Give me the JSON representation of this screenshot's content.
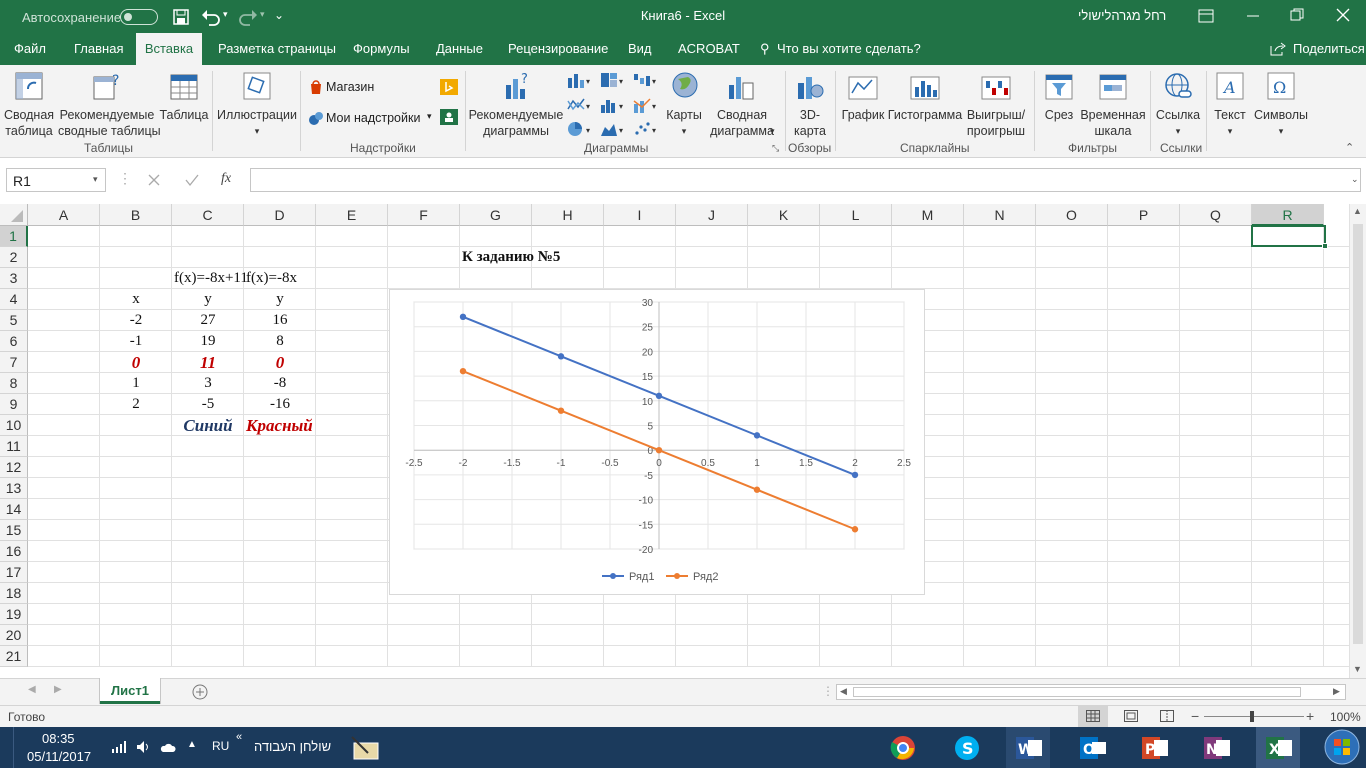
{
  "titlebar": {
    "autosave_label": "Автосохранение",
    "title": "Книга6  -  Excel",
    "user": "רחל מגרהלישולי"
  },
  "tabs": [
    "Файл",
    "Главная",
    "Вставка",
    "Разметка страницы",
    "Формулы",
    "Данные",
    "Рецензирование",
    "Вид",
    "ACROBAT"
  ],
  "active_tab": "Вставка",
  "tell_me": "Что вы хотите сделать?",
  "share": "Поделиться",
  "ribbon": {
    "pivot": [
      "Сводная",
      "таблица"
    ],
    "rec_pivot": [
      "Рекомендуемые",
      "сводные таблицы"
    ],
    "table": "Таблица",
    "illustrations": "Иллюстрации",
    "store": "Магазин",
    "my_addins": "Мои надстройки",
    "rec_charts": [
      "Рекомендуемые",
      "диаграммы"
    ],
    "maps": "Карты",
    "pivot_chart": [
      "Сводная",
      "диаграмма"
    ],
    "map3d": [
      "3D-",
      "карта"
    ],
    "line": "График",
    "hist": "Гистограмма",
    "winloss": [
      "Выигрыш/",
      "проигрыш"
    ],
    "slicer": "Срез",
    "timeline": [
      "Временная",
      "шкала"
    ],
    "link": "Ссылка",
    "text": "Текст",
    "symbols": "Символы",
    "groups": {
      "tables": "Таблицы",
      "addins": "Надстройки",
      "charts": "Диаграммы",
      "tours": "Обзоры",
      "sparklines": "Спарклайны",
      "filters": "Фильтры",
      "links": "Ссылки"
    }
  },
  "formula": {
    "namebox": "R1",
    "fx": "fx",
    "value": ""
  },
  "columns": [
    "A",
    "B",
    "C",
    "D",
    "E",
    "F",
    "G",
    "H",
    "I",
    "J",
    "K",
    "L",
    "M",
    "N",
    "O",
    "P",
    "Q",
    "R"
  ],
  "rows": [
    "1",
    "2",
    "3",
    "4",
    "5",
    "6",
    "7",
    "8",
    "9",
    "10",
    "11",
    "12",
    "13",
    "14",
    "15",
    "16",
    "17",
    "18",
    "19",
    "20",
    "21"
  ],
  "cells": {
    "G2": "К заданию №5",
    "C3": "f(x)=-8x+11",
    "D3": "f(x)=-8x",
    "B4": "x",
    "C4": "y",
    "D4": "y",
    "B5": "-2",
    "C5": "27",
    "D5": "16",
    "B6": "-1",
    "C6": "19",
    "D6": "8",
    "B7": "0",
    "C7": "11",
    "D7": "0",
    "B8": "1",
    "C8": "3",
    "D8": "-8",
    "B9": "2",
    "C9": "-5",
    "D9": "-16",
    "C10": "Синий",
    "D10": "Красный"
  },
  "colors": {
    "excel_green": "#217346",
    "red_text": "#c00000",
    "blue_text": "#1f3864",
    "series1": "#4472c4",
    "series2": "#ed7d31"
  },
  "chart_data": {
    "type": "scatter",
    "x": [
      -2,
      -1,
      0,
      1,
      2
    ],
    "series": [
      {
        "name": "Ряд1",
        "values": [
          27,
          19,
          11,
          3,
          -5
        ],
        "color": "#4472c4"
      },
      {
        "name": "Ряд2",
        "values": [
          16,
          8,
          0,
          -8,
          -16
        ],
        "color": "#ed7d31"
      }
    ],
    "xlim": [
      -2.5,
      2.5
    ],
    "ylim": [
      -20,
      30
    ],
    "x_ticks": [
      "-2.5",
      "-2",
      "-1.5",
      "-1",
      "-0.5",
      "0",
      "0.5",
      "1",
      "1.5",
      "2",
      "2.5"
    ],
    "y_ticks": [
      "30",
      "25",
      "20",
      "15",
      "10",
      "5",
      "0",
      "-5",
      "-10",
      "-15",
      "-20"
    ],
    "grid": true,
    "legend": "bottom"
  },
  "sheet": {
    "name": "Лист1"
  },
  "status": {
    "ready": "Готово",
    "zoom": "100%"
  },
  "taskbar": {
    "time": "08:35",
    "date": "05/11/2017",
    "lang": "RU",
    "desktop": "שולחן העבודה"
  }
}
